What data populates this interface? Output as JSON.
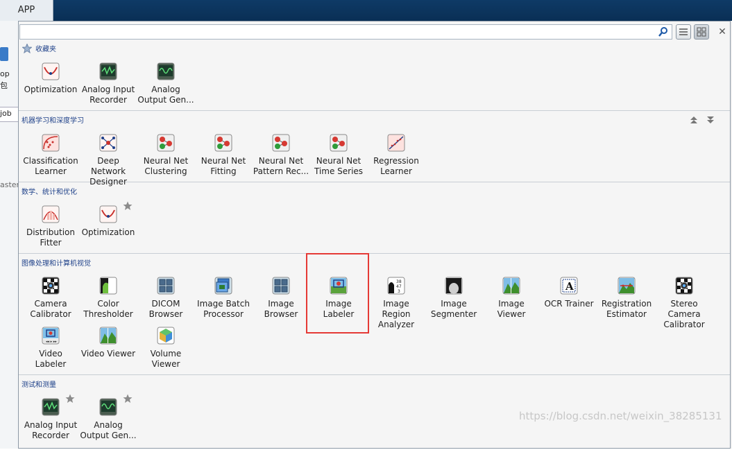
{
  "window": {
    "tab_label": "APP"
  },
  "background": {
    "label_top": "op",
    "label_bottom": "包",
    "row_text": "job",
    "side_text": "aster"
  },
  "search": {
    "value": "",
    "placeholder": ""
  },
  "sections": [
    {
      "id": "favorites",
      "title": "收藏夹",
      "items": [
        {
          "name": "optimization",
          "label": "Optimization",
          "icon": "optimization-icon",
          "star": false
        },
        {
          "name": "analog-input-recorder",
          "label": "Analog Input\nRecorder",
          "icon": "analog-input-recorder-icon",
          "star": false
        },
        {
          "name": "analog-output-generator",
          "label": "Analog\nOutput Gen...",
          "icon": "analog-output-generator-icon",
          "star": false
        }
      ]
    },
    {
      "id": "machine-learning",
      "title": "机器学习和深度学习",
      "items": [
        {
          "name": "classification-learner",
          "label": "Classification\nLearner",
          "icon": "classification-learner-icon",
          "star": false
        },
        {
          "name": "deep-network-designer",
          "label": "Deep Network\nDesigner",
          "icon": "deep-network-designer-icon",
          "star": false
        },
        {
          "name": "neural-net-clustering",
          "label": "Neural Net\nClustering",
          "icon": "neural-net-clustering-icon",
          "star": false
        },
        {
          "name": "neural-net-fitting",
          "label": "Neural Net\nFitting",
          "icon": "neural-net-fitting-icon",
          "star": false
        },
        {
          "name": "neural-net-pattern-recognition",
          "label": "Neural Net\nPattern Rec...",
          "icon": "neural-net-pattern-icon",
          "star": false
        },
        {
          "name": "neural-net-time-series",
          "label": "Neural Net\nTime Series",
          "icon": "neural-net-time-series-icon",
          "star": false
        },
        {
          "name": "regression-learner",
          "label": "Regression\nLearner",
          "icon": "regression-learner-icon",
          "star": false
        }
      ]
    },
    {
      "id": "math-stats-optimization",
      "title": "数学、统计和优化",
      "items": [
        {
          "name": "distribution-fitter",
          "label": "Distribution\nFitter",
          "icon": "distribution-fitter-icon",
          "star": false
        },
        {
          "name": "optimization-math",
          "label": "Optimization",
          "icon": "optimization-icon",
          "star": true
        }
      ]
    },
    {
      "id": "image-processing",
      "title": "图像处理和计算机视觉",
      "items": [
        {
          "name": "camera-calibrator",
          "label": "Camera\nCalibrator",
          "icon": "camera-calibrator-icon",
          "star": false
        },
        {
          "name": "color-thresholder",
          "label": "Color\nThresholder",
          "icon": "color-thresholder-icon",
          "star": false
        },
        {
          "name": "dicom-browser",
          "label": "DICOM\nBrowser",
          "icon": "dicom-browser-icon",
          "star": false
        },
        {
          "name": "image-batch-processor",
          "label": "Image Batch\nProcessor",
          "icon": "image-batch-processor-icon",
          "star": false
        },
        {
          "name": "image-browser",
          "label": "Image\nBrowser",
          "icon": "image-browser-icon",
          "star": false
        },
        {
          "name": "image-labeler",
          "label": "Image Labeler",
          "icon": "image-labeler-icon",
          "star": false
        },
        {
          "name": "image-region-analyzer",
          "label": "Image Region\nAnalyzer",
          "icon": "image-region-analyzer-icon",
          "star": false
        },
        {
          "name": "image-segmenter",
          "label": "Image\nSegmenter",
          "icon": "image-segmenter-icon",
          "star": false
        },
        {
          "name": "image-viewer",
          "label": "Image Viewer",
          "icon": "image-viewer-icon",
          "star": false
        },
        {
          "name": "ocr-trainer",
          "label": "OCR Trainer",
          "icon": "ocr-trainer-icon",
          "star": false
        },
        {
          "name": "registration-estimator",
          "label": "Registration\nEstimator",
          "icon": "registration-estimator-icon",
          "star": false
        },
        {
          "name": "stereo-camera-calibrator",
          "label": "Stereo Camera\nCalibrator",
          "icon": "stereo-camera-calibrator-icon",
          "star": false
        },
        {
          "name": "video-labeler",
          "label": "Video Labeler",
          "icon": "video-labeler-icon",
          "star": false
        },
        {
          "name": "video-viewer",
          "label": "Video Viewer",
          "icon": "video-viewer-icon",
          "star": false
        },
        {
          "name": "volume-viewer",
          "label": "Volume\nViewer",
          "icon": "volume-viewer-icon",
          "star": false
        }
      ]
    },
    {
      "id": "test-measurement",
      "title": "测试和测量",
      "items": [
        {
          "name": "analog-input-recorder-tm",
          "label": "Analog Input\nRecorder",
          "icon": "analog-input-recorder-icon",
          "star": true
        },
        {
          "name": "analog-output-generator-tm",
          "label": "Analog\nOutput Gen...",
          "icon": "analog-output-generator-icon",
          "star": true
        }
      ]
    }
  ],
  "highlighted_item": "image-labeler",
  "watermark": "https://blog.csdn.net/weixin_38285131",
  "colors": {
    "highlight": "#e53935",
    "section_title": "#20428a",
    "tab_strip": "#0e3a66"
  }
}
